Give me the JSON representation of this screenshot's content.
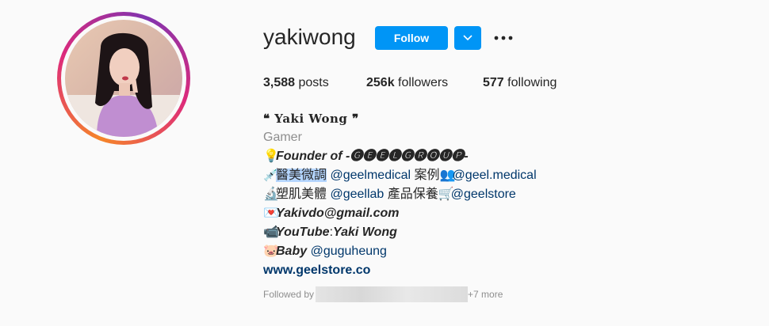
{
  "profile": {
    "username": "yakiwong",
    "follow_label": "Follow",
    "stats": {
      "posts_count": "3,588",
      "posts_label": " posts",
      "followers_count": "256k",
      "followers_label": " followers",
      "following_count": "577",
      "following_label": " following"
    },
    "bio": {
      "full_name": "❝ Yaki Wong ❞",
      "category": "Gamer",
      "line1_emoji": "💡",
      "line1_text": "Founder of -🅖🅔🅔🅛🅖🅡🅞🅤🅟-",
      "line2_emoji": "💉",
      "line2_highlight": "醫美微調",
      "line2_mention1": "@geelmedical",
      "line2_mid": " 案例",
      "line2_emoji2": "👥",
      "line2_mention2": "@geel.medical",
      "line3_emoji": "🔬",
      "line3_text": "塑肌美體 ",
      "line3_mention1": "@geellab",
      "line3_mid": " 產品保養",
      "line3_emoji2": "🛒",
      "line3_mention2": "@geelstore",
      "line4_emoji": "💌",
      "line4_text": "Yakivdo@gmail.com",
      "line5_emoji": "📹",
      "line5_text1": "YouTube",
      "line5_colon": ":",
      "line5_text2": "Yaki Wong",
      "line6_emoji": "🐷",
      "line6_text": "Baby ",
      "line6_mention": "@guguheung",
      "website": "www.geelstore.co"
    },
    "followed_by_label": "Followed by",
    "followed_by_more": "+7 more"
  },
  "colors": {
    "accent": "#0095f6",
    "link": "#00376b",
    "muted": "#8e8e8e",
    "text": "#262626"
  },
  "icons": {
    "dropdown": "chevron-down-icon",
    "more": "more-horizontal-icon"
  }
}
